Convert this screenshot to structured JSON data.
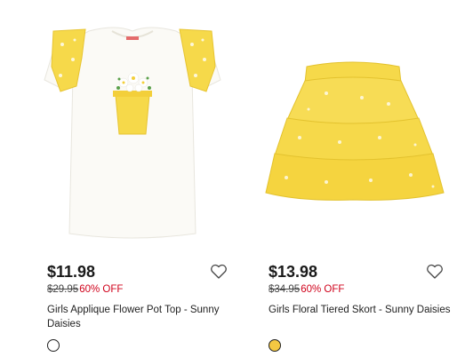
{
  "products": [
    {
      "price": "$11.98",
      "original_price": "$29.95",
      "discount": "60% OFF",
      "name": "Girls Applique Flower Pot Top - Sunny Daisies",
      "swatch_color": "#ffffff",
      "image_label": "applique-top-image"
    },
    {
      "price": "$13.98",
      "original_price": "$34.95",
      "discount": "60% OFF",
      "name": "Girls Floral Tiered Skort - Sunny Daisies",
      "swatch_color": "#f4c842",
      "image_label": "tiered-skort-image"
    }
  ],
  "colors": {
    "discount": "#d0021b",
    "yellow": "#f6d94a",
    "shirt": "#fbfaf6"
  },
  "icons": {
    "favorite": "heart-icon"
  }
}
